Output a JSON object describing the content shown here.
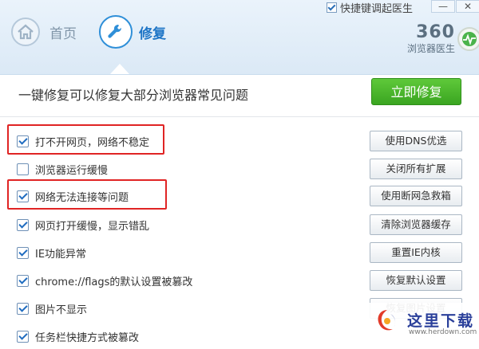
{
  "window": {
    "shortcut_label": "快捷键调起医生",
    "minimize_glyph": "—",
    "close_glyph": "✕"
  },
  "nav": {
    "home_label": "首页",
    "repair_label": "修复"
  },
  "brand": {
    "number": "360",
    "subtitle": "浏览器医生"
  },
  "header": {
    "headline": "一键修复可以修复大部分浏览器常见问题",
    "repair_button": "立即修复"
  },
  "items": [
    {
      "label": "打不开网页，网络不稳定",
      "checked": true,
      "button": "使用DNS优选",
      "highlighted": true
    },
    {
      "label": "浏览器运行缓慢",
      "checked": false,
      "button": "关闭所有扩展",
      "highlighted": false
    },
    {
      "label": "网络无法连接等问题",
      "checked": true,
      "button": "使用断网急救箱",
      "highlighted": true
    },
    {
      "label": "网页打开缓慢，显示错乱",
      "checked": true,
      "button": "清除浏览器缓存",
      "highlighted": false
    },
    {
      "label": "IE功能异常",
      "checked": true,
      "button": "重置IE内核",
      "highlighted": false
    },
    {
      "label": "chrome://flags的默认设置被篡改",
      "checked": true,
      "button": "恢复默认设置",
      "highlighted": false
    },
    {
      "label": "图片不显示",
      "checked": true,
      "button": "恢复图片设置",
      "highlighted": false
    },
    {
      "label": "任务栏快捷方式被篡改",
      "checked": true,
      "button": "",
      "highlighted": false
    }
  ],
  "watermark": {
    "text": "这里下载",
    "url": "www.herdown.com"
  },
  "colors": {
    "accent_blue": "#1e75c6",
    "repair_green": "#3aa521",
    "highlight_red": "#e02424"
  }
}
